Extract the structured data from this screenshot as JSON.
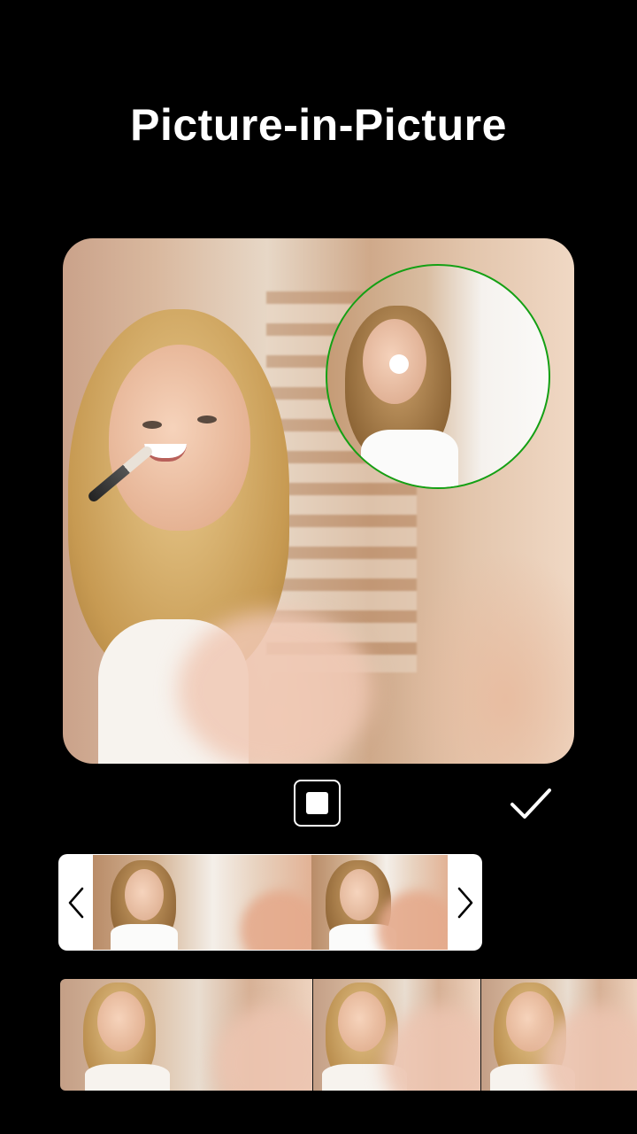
{
  "header": {
    "title": "Picture-in-Picture"
  },
  "preview": {
    "overlay_shape": "circle",
    "overlay_border_color": "#14a014"
  },
  "controls": {
    "shape_toggle_icon": "square-shape-icon",
    "confirm_icon": "checkmark-icon"
  },
  "clip_strip": {
    "prev_icon": "chevron-left-icon",
    "next_icon": "chevron-right-icon",
    "frame_count": 2
  },
  "timeline": {
    "frame_count": 3
  },
  "colors": {
    "background": "#000000",
    "text": "#ffffff",
    "accent": "#14a014"
  }
}
